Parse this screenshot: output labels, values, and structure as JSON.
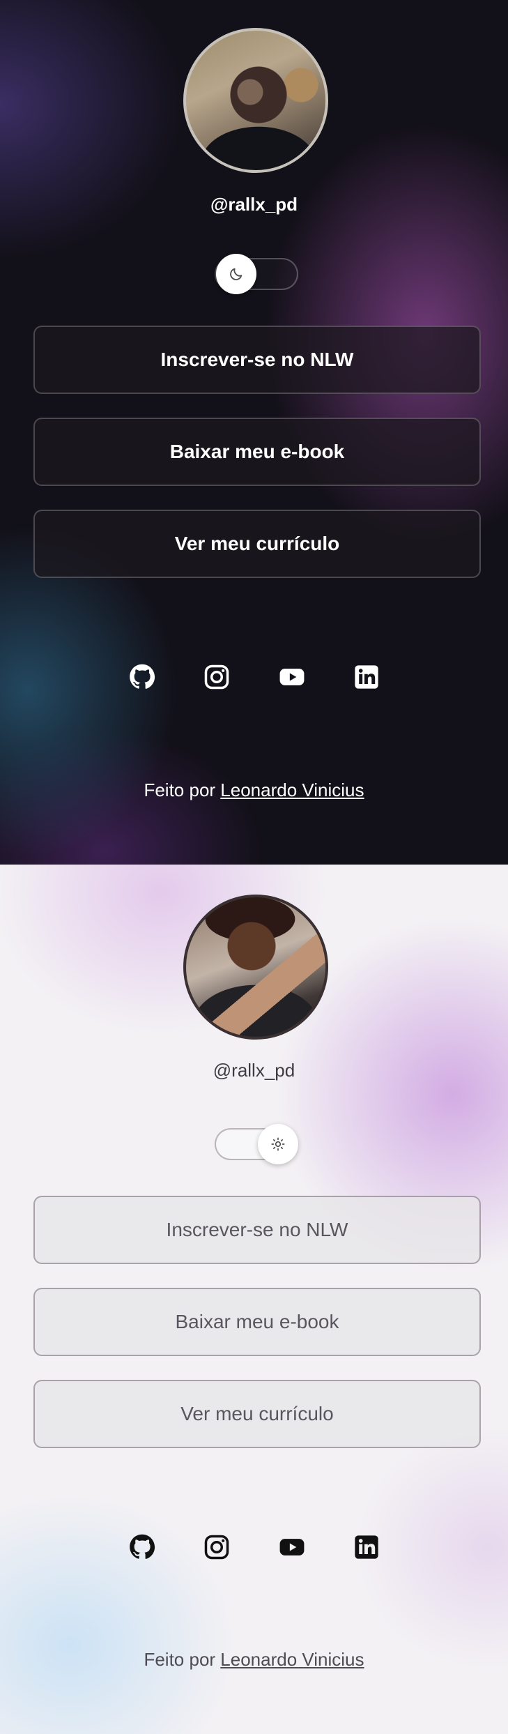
{
  "dark_theme": {
    "profile": {
      "avatar_icon": "profile-avatar",
      "handle": "@rallx_pd"
    },
    "theme_toggle": {
      "icon": "moon-icon",
      "state": "dark"
    },
    "links": [
      {
        "label": "Inscrever-se no NLW"
      },
      {
        "label": "Baixar meu e-book"
      },
      {
        "label": "Ver meu currículo"
      }
    ],
    "social_icons": [
      "github-icon",
      "instagram-icon",
      "youtube-icon",
      "linkedin-icon"
    ],
    "footer": {
      "prefix": "Feito por",
      "author_link": "Leonardo Vinicius"
    }
  },
  "light_theme": {
    "profile": {
      "avatar_icon": "profile-avatar",
      "handle": "@rallx_pd"
    },
    "theme_toggle": {
      "icon": "sun-icon",
      "state": "light"
    },
    "links": [
      {
        "label": "Inscrever-se no NLW"
      },
      {
        "label": "Baixar meu e-book"
      },
      {
        "label": "Ver meu currículo"
      }
    ],
    "social_icons": [
      "github-icon",
      "instagram-icon",
      "youtube-icon",
      "linkedin-icon"
    ],
    "footer": {
      "prefix": "Feito por",
      "author_link": "Leonardo Vinicius"
    }
  }
}
